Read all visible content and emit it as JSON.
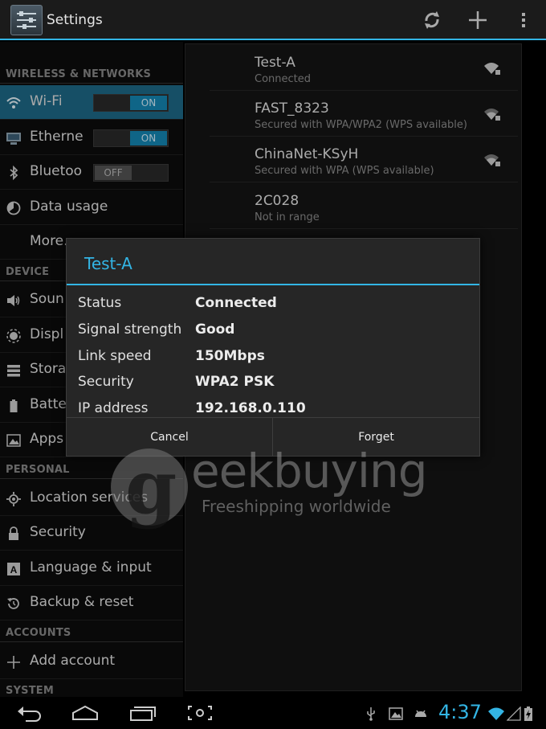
{
  "action_bar": {
    "title": "Settings",
    "icons": [
      "settings-app-icon",
      "scan-icon",
      "add-network-icon",
      "overflow-menu-icon"
    ]
  },
  "sidebar": {
    "sections": {
      "wireless": "WIRELESS & NETWORKS",
      "device": "DEVICE",
      "personal": "PERSONAL",
      "accounts": "ACCOUNTS",
      "system": "SYSTEM"
    },
    "items": [
      {
        "label": "Wi-Fi",
        "icon": "wifi-icon",
        "toggle": "ON"
      },
      {
        "label": "Etherne",
        "icon": "ethernet-icon",
        "toggle": "ON"
      },
      {
        "label": "Bluetoo",
        "icon": "bluetooth-icon",
        "toggle": "OFF"
      },
      {
        "label": "Data usage",
        "icon": "data-usage-icon"
      },
      {
        "label": "More...",
        "icon": ""
      },
      {
        "label": "Soun",
        "icon": "sound-icon"
      },
      {
        "label": "Displ",
        "icon": "display-icon"
      },
      {
        "label": "Stora",
        "icon": "storage-icon"
      },
      {
        "label": "Batte",
        "icon": "battery-icon"
      },
      {
        "label": "Apps",
        "icon": "apps-icon"
      },
      {
        "label": "Location services",
        "icon": "location-icon"
      },
      {
        "label": "Security",
        "icon": "lock-icon"
      },
      {
        "label": "Language & input",
        "icon": "language-icon"
      },
      {
        "label": "Backup & reset",
        "icon": "backup-icon"
      },
      {
        "label": "Add account",
        "icon": "plus-icon"
      }
    ]
  },
  "networks": [
    {
      "ssid": "Test-A",
      "status": "Connected"
    },
    {
      "ssid": "FAST_8323",
      "status": "Secured with WPA/WPA2 (WPS available)"
    },
    {
      "ssid": "ChinaNet-KSyH",
      "status": "Secured with WPA (WPS available)"
    },
    {
      "ssid": "2C028",
      "status": "Not in range"
    }
  ],
  "dialog": {
    "title": "Test-A",
    "rows": [
      {
        "key": "Status",
        "value": "Connected"
      },
      {
        "key": "Signal strength",
        "value": "Good"
      },
      {
        "key": "Link speed",
        "value": "150Mbps"
      },
      {
        "key": "Security",
        "value": "WPA2 PSK"
      },
      {
        "key": "IP address",
        "value": "192.168.0.110"
      }
    ],
    "buttons": {
      "cancel": "Cancel",
      "forget": "Forget"
    }
  },
  "watermark": {
    "letter": "g",
    "word": "eekbuying",
    "tagline": "Freeshipping worldwide"
  },
  "status_bar": {
    "time": "4:37"
  },
  "colors": {
    "accent": "#33b5e5",
    "selected": "#1e6a88"
  }
}
